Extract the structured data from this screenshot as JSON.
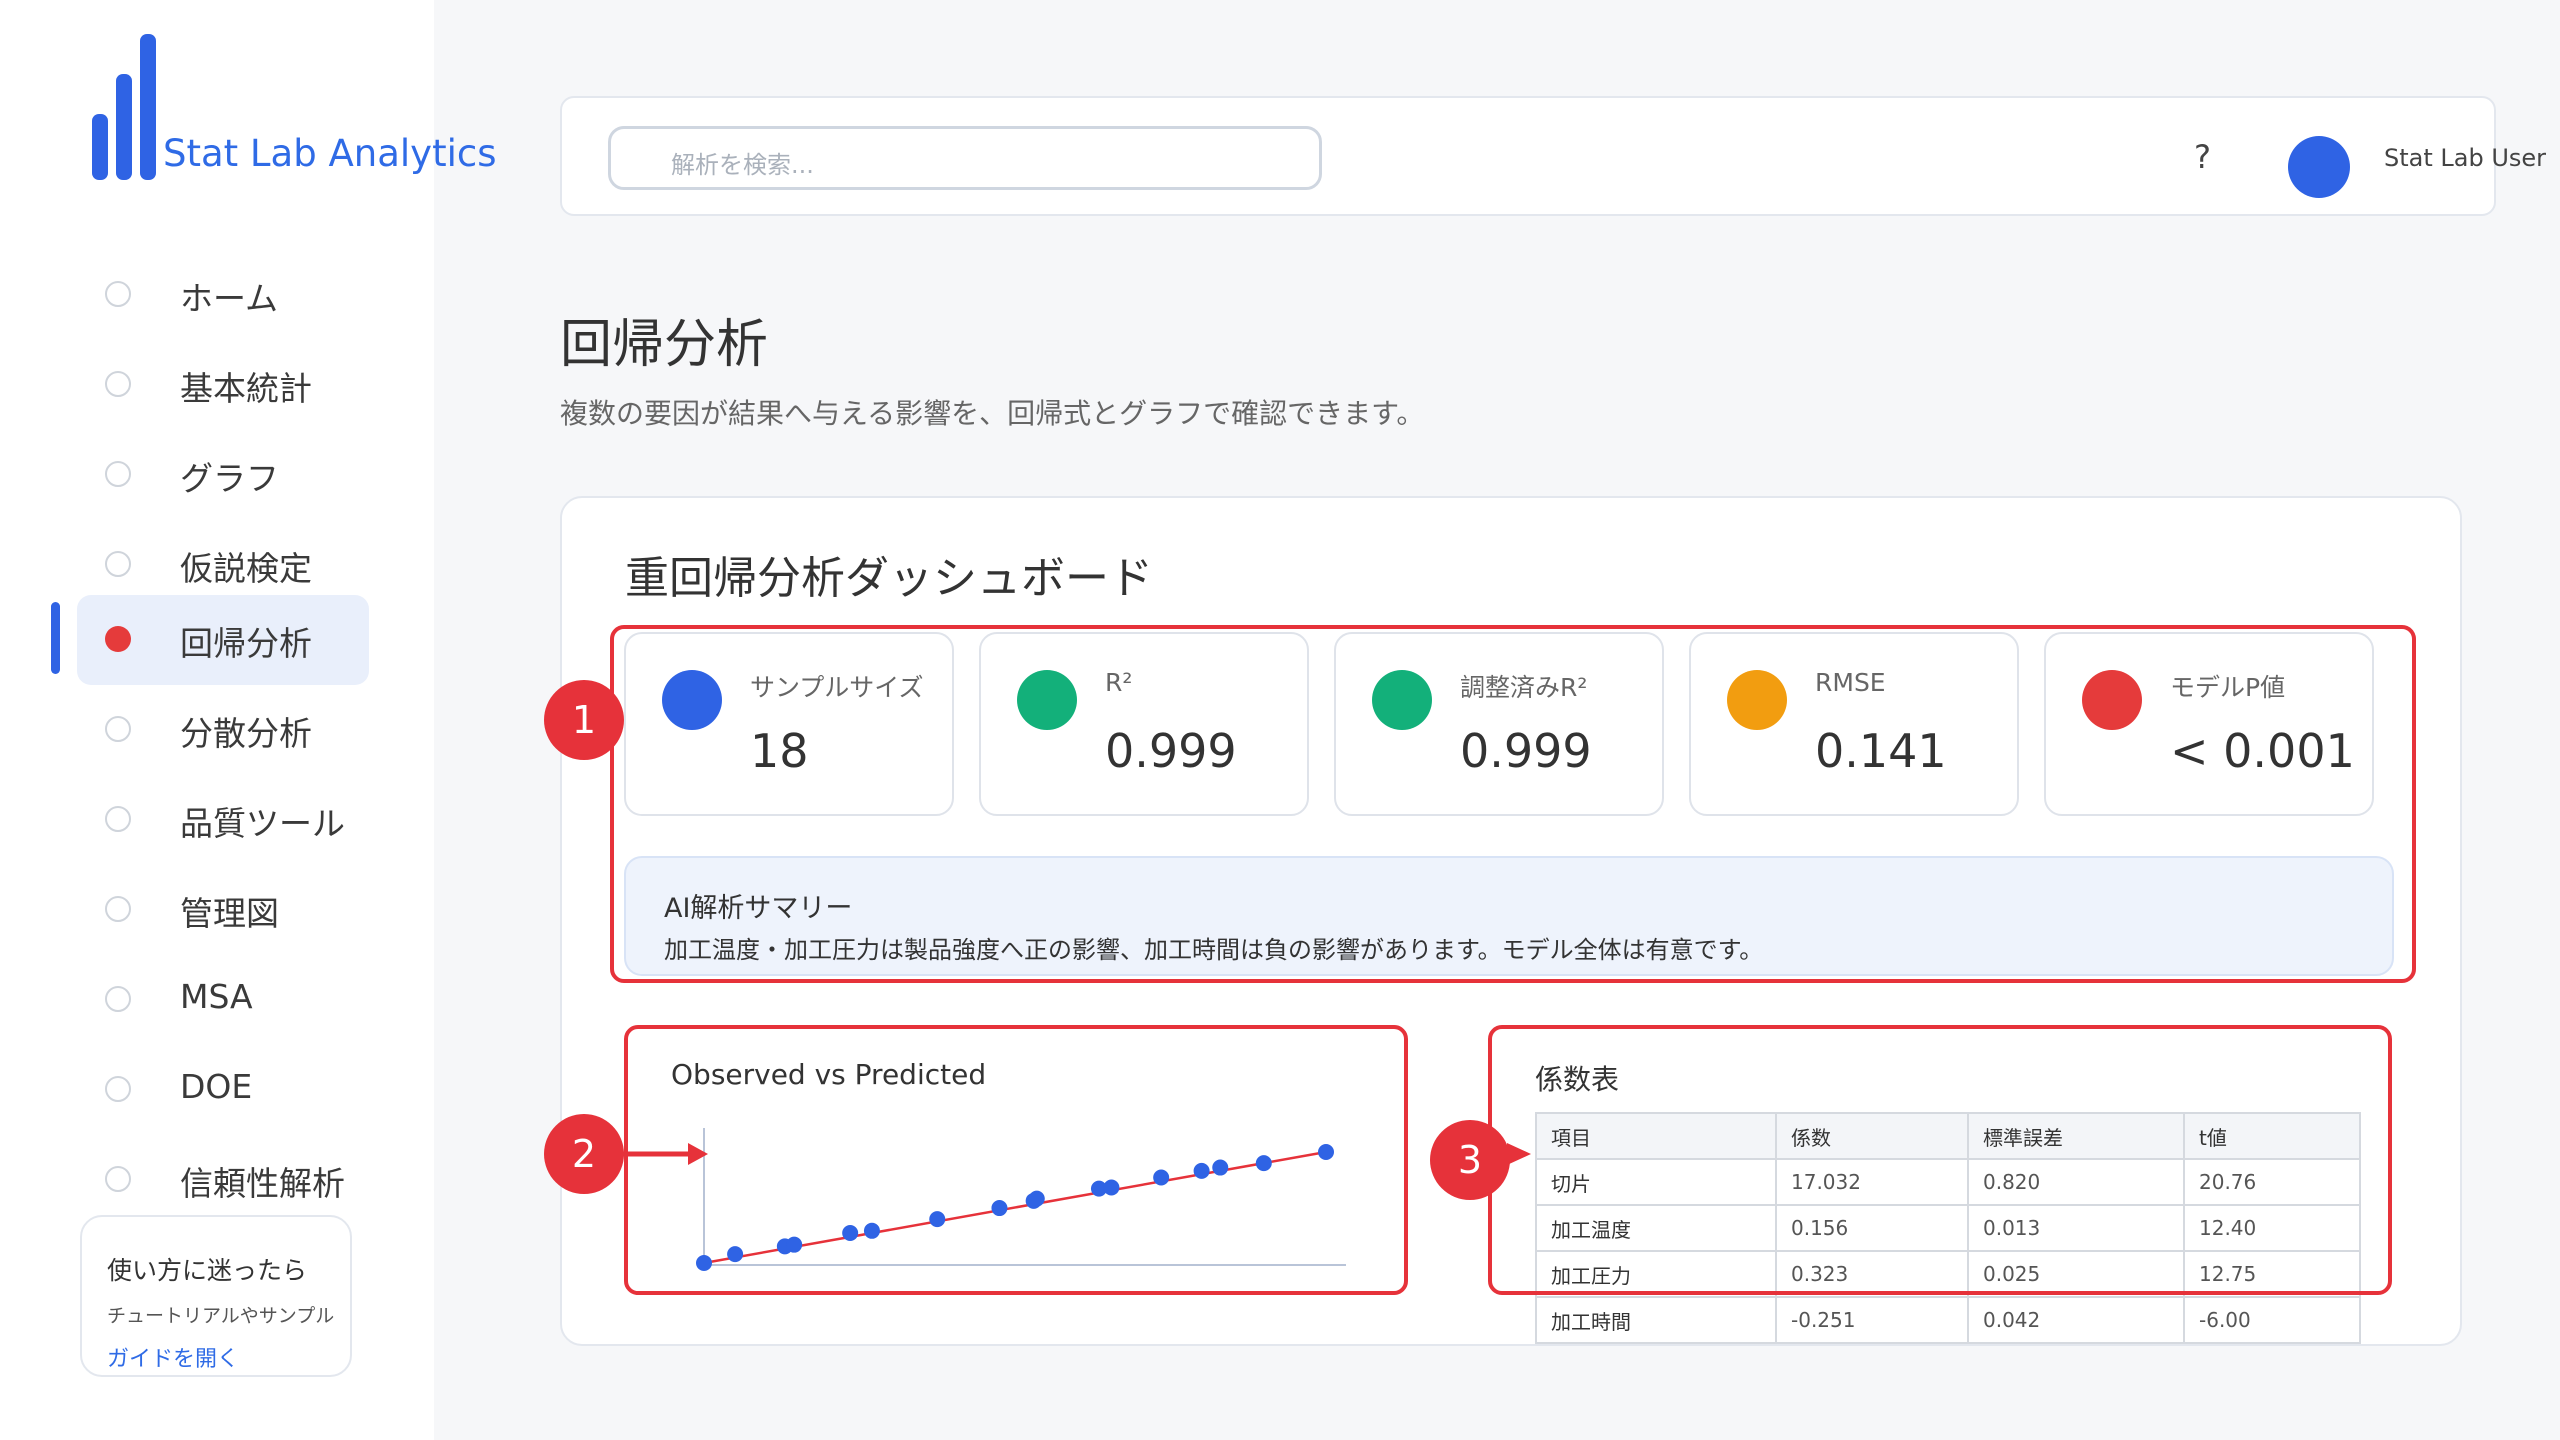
{
  "app": {
    "brand": "Stat Lab Analytics"
  },
  "sidebar": {
    "items": [
      {
        "label": "ホーム",
        "active": false
      },
      {
        "label": "基本統計",
        "active": false
      },
      {
        "label": "グラフ",
        "active": false
      },
      {
        "label": "仮説検定",
        "active": false
      },
      {
        "label": "回帰分析",
        "active": true
      },
      {
        "label": "分散分析",
        "active": false
      },
      {
        "label": "品質ツール",
        "active": false
      },
      {
        "label": "管理図",
        "active": false
      },
      {
        "label": "MSA",
        "active": false
      },
      {
        "label": "DOE",
        "active": false
      },
      {
        "label": "信頼性解析",
        "active": false
      }
    ],
    "help": {
      "title": "使い方に迷ったら",
      "subtitle": "チュートリアルやサンプル",
      "link": "ガイドを開く"
    }
  },
  "header": {
    "search_placeholder": "解析を検索...",
    "help_label": "?",
    "user_name": "Stat Lab User"
  },
  "page": {
    "title": "回帰分析",
    "description": "複数の要因が結果へ与える影響を、回帰式とグラフで確認できます。"
  },
  "dashboard": {
    "title": "重回帰分析ダッシュボード",
    "metrics": [
      {
        "label": "サンプルサイズ",
        "value": "18",
        "color": "#2f63e4"
      },
      {
        "label": "R²",
        "value": "0.999",
        "color": "#13b07a"
      },
      {
        "label": "調整済みR²",
        "value": "0.999",
        "color": "#13b07a"
      },
      {
        "label": "RMSE",
        "value": "0.141",
        "color": "#f29d10"
      },
      {
        "label": "モデルP値",
        "value": "< 0.001",
        "color": "#e53b3b"
      }
    ],
    "summary": {
      "title": "AI解析サマリー",
      "text": "加工温度・加工圧力は製品強度へ正の影響、加工時間は負の影響があります。モデル全体は有意です。"
    },
    "coefficients": {
      "title": "係数表",
      "headers": [
        "項目",
        "係数",
        "標準誤差",
        "t値"
      ],
      "rows": [
        [
          "切片",
          "17.032",
          "0.820",
          "20.76"
        ],
        [
          "加工温度",
          "0.156",
          "0.013",
          "12.40"
        ],
        [
          "加工圧力",
          "0.323",
          "0.025",
          "12.75"
        ],
        [
          "加工時間",
          "-0.251",
          "0.042",
          "-6.00"
        ]
      ]
    }
  },
  "chart_data": {
    "type": "scatter",
    "title": "Observed vs Predicted",
    "x": [
      0.0,
      0.05,
      0.13,
      0.145,
      0.235,
      0.27,
      0.375,
      0.475,
      0.53,
      0.535,
      0.635,
      0.655,
      0.735,
      0.8,
      0.83,
      0.9,
      1.0
    ],
    "y": [
      0.0,
      0.08,
      0.15,
      0.165,
      0.27,
      0.29,
      0.395,
      0.495,
      0.56,
      0.58,
      0.67,
      0.68,
      0.77,
      0.83,
      0.86,
      0.9,
      1.0
    ],
    "fit_line": true,
    "point_color": "#2f63e4",
    "line_color": "#e6323a"
  },
  "annotations": [
    {
      "label": "1"
    },
    {
      "label": "2"
    },
    {
      "label": "3"
    }
  ]
}
